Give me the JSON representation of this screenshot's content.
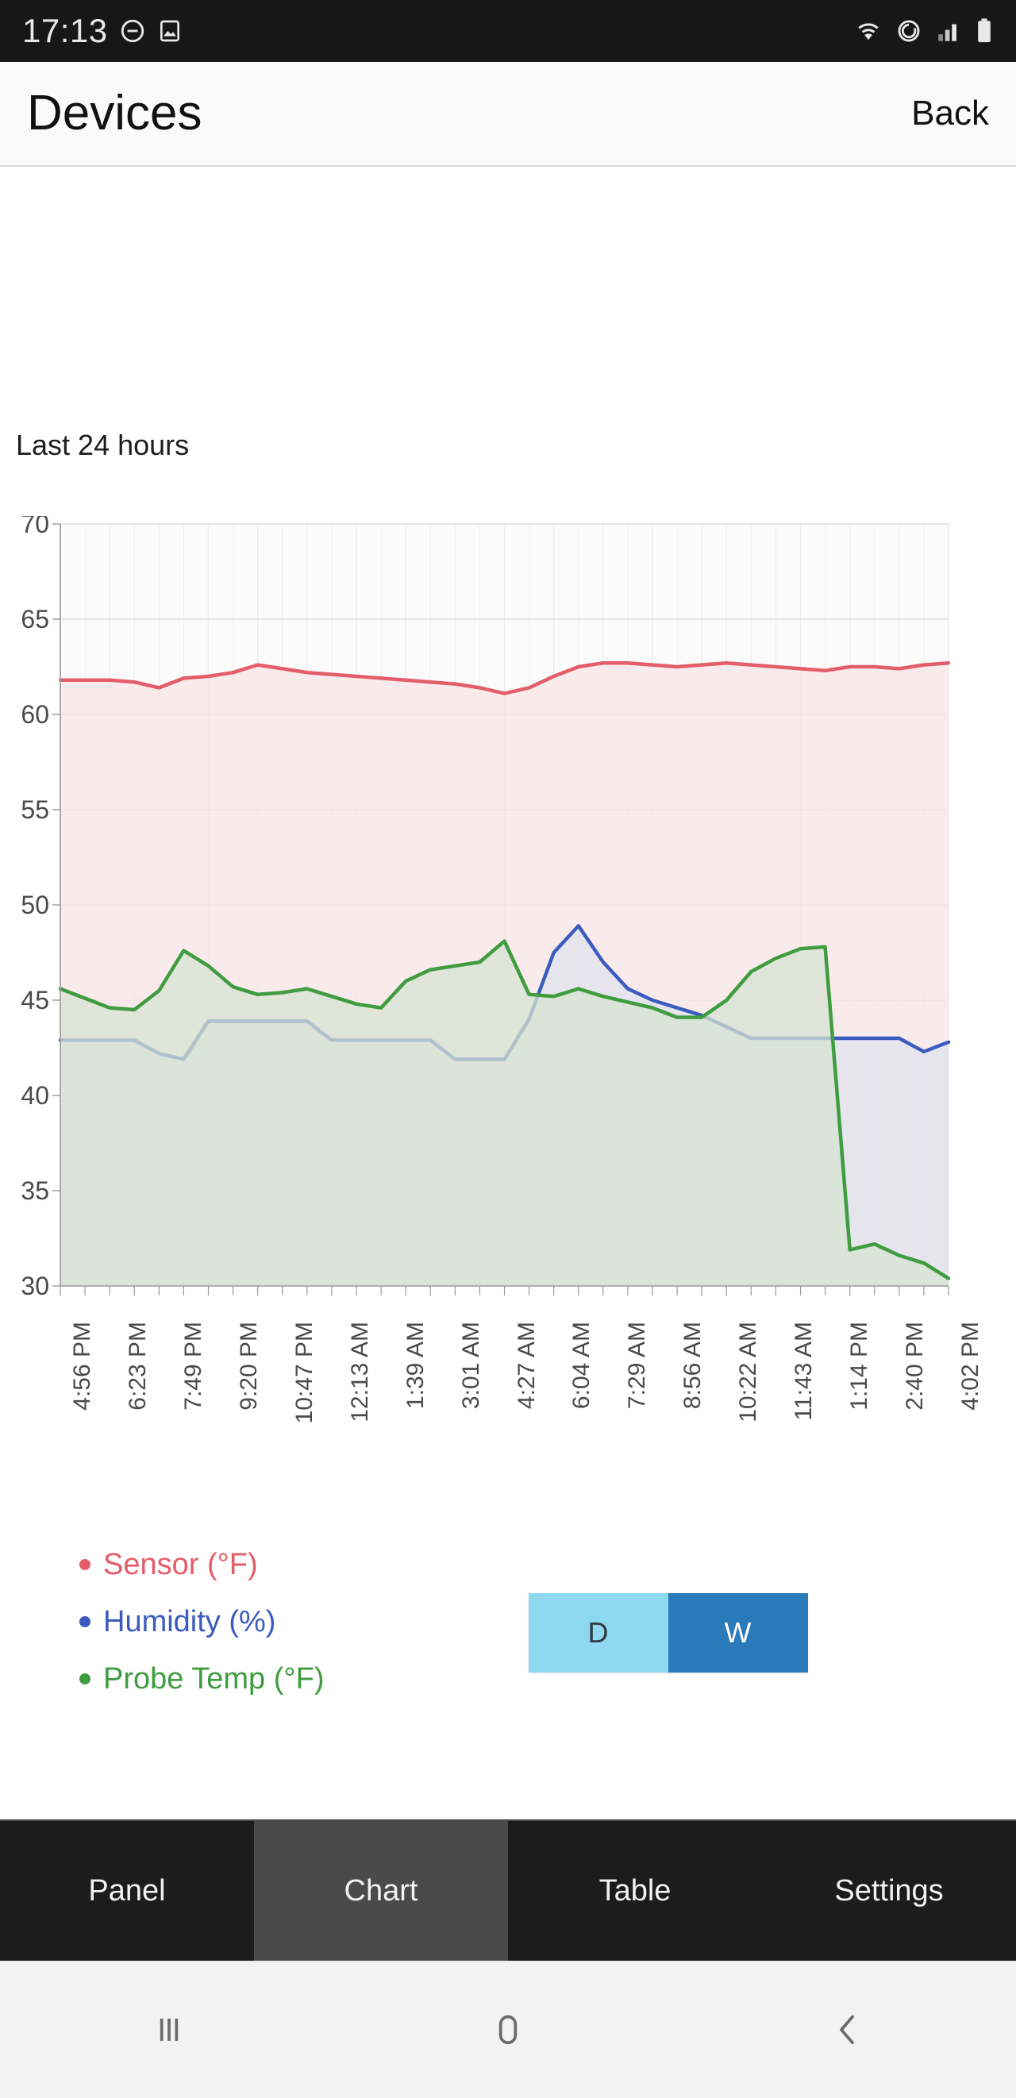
{
  "statusbar": {
    "time": "17:13",
    "left_icons": [
      "do-not-disturb-icon",
      "screenshot-icon"
    ],
    "right_icons": [
      "wifi-icon",
      "sync-icon",
      "signal-icon",
      "battery-icon"
    ]
  },
  "header": {
    "title": "Devices",
    "back_label": "Back"
  },
  "main": {
    "range_label": "Last 24 hours"
  },
  "legend": {
    "items": [
      {
        "label": "Sensor (°F)",
        "color": "#e35d6a"
      },
      {
        "label": "Humidity (%)",
        "color": "#3b5bbf"
      },
      {
        "label": "Probe Temp (°F)",
        "color": "#3f9c3f"
      }
    ]
  },
  "range_toggle": {
    "options": [
      {
        "label": "D",
        "selected": false,
        "bg": "#8ed8f0",
        "fg": "#2f3b42"
      },
      {
        "label": "W",
        "selected": true,
        "bg": "#2a7ab9",
        "fg": "#ffffff"
      }
    ]
  },
  "tabs": [
    {
      "label": "Panel",
      "active": false
    },
    {
      "label": "Chart",
      "active": true
    },
    {
      "label": "Table",
      "active": false
    },
    {
      "label": "Settings",
      "active": false
    }
  ],
  "navbar": {
    "items": [
      {
        "name": "recents-icon"
      },
      {
        "name": "home-icon"
      },
      {
        "name": "back-icon"
      }
    ]
  },
  "chart_data": {
    "type": "line",
    "title": "Last 24 hours",
    "xlabel": "",
    "ylabel": "",
    "ylim": [
      30,
      70
    ],
    "yticks": [
      30,
      35,
      40,
      45,
      50,
      55,
      60,
      65,
      70
    ],
    "grid": true,
    "legend_position": "below-left",
    "filled_area": true,
    "xtick_labels": [
      "4:56 PM",
      "6:23 PM",
      "7:49 PM",
      "9:20 PM",
      "10:47 PM",
      "12:13 AM",
      "1:39 AM",
      "3:01 AM",
      "4:27 AM",
      "6:04 AM",
      "7:29 AM",
      "8:56 AM",
      "10:22 AM",
      "11:43 AM",
      "1:14 PM",
      "2:40 PM",
      "4:02 PM"
    ],
    "series": [
      {
        "name": "Sensor (°F)",
        "color": "#e35d6a",
        "fill": "#f8e6e6",
        "values": [
          61.8,
          61.8,
          61.8,
          61.7,
          61.4,
          61.9,
          62.0,
          62.2,
          62.6,
          62.4,
          62.2,
          62.1,
          62.0,
          61.9,
          61.8,
          61.7,
          61.6,
          61.4,
          61.1,
          61.4,
          62.0,
          62.5,
          62.7,
          62.7,
          62.6,
          62.5,
          62.6,
          62.7,
          62.6,
          62.5,
          62.4,
          62.3,
          62.5,
          62.5,
          62.4,
          62.6,
          62.7
        ]
      },
      {
        "name": "Humidity (%)",
        "color": "#3b5bbf",
        "fill": "#dfe3ef",
        "values": [
          42.9,
          42.9,
          42.9,
          42.9,
          42.2,
          41.9,
          43.9,
          43.9,
          43.9,
          43.9,
          43.9,
          42.9,
          42.9,
          42.9,
          42.9,
          42.9,
          41.9,
          41.9,
          41.9,
          44.0,
          47.5,
          48.9,
          47.0,
          45.6,
          45.0,
          44.6,
          44.2,
          43.6,
          43.0,
          43.0,
          43.0,
          43.0,
          43.0,
          43.0,
          43.0,
          42.3,
          42.8
        ]
      },
      {
        "name": "Probe Temp (°F)",
        "color": "#3f9c3f",
        "fill": "#d6e3d2",
        "values": [
          45.6,
          45.1,
          44.6,
          44.5,
          45.5,
          47.6,
          46.8,
          45.7,
          45.3,
          45.4,
          45.6,
          45.2,
          44.8,
          44.6,
          46.0,
          46.6,
          46.8,
          47.0,
          48.1,
          45.3,
          45.2,
          45.6,
          45.2,
          44.9,
          44.6,
          44.1,
          44.1,
          45.0,
          46.5,
          47.2,
          47.7,
          47.8,
          31.9,
          32.2,
          31.6,
          31.2,
          30.4
        ]
      }
    ]
  }
}
